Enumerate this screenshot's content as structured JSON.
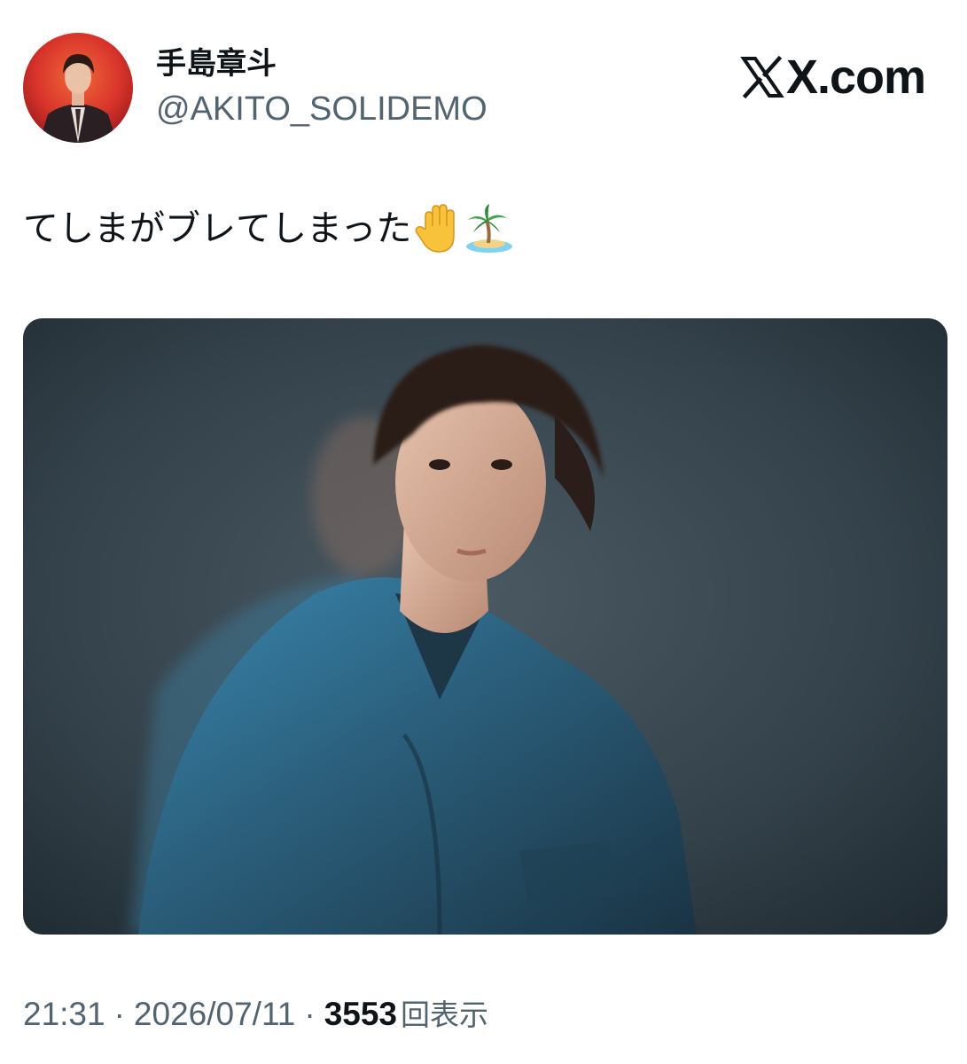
{
  "tweet": {
    "author": {
      "display_name": "手島章斗",
      "handle": "@AKITO_SOLIDEMO"
    },
    "brand": {
      "text": "X.com",
      "icon": "x-logo-icon"
    },
    "text": "てしまがブレてしまった",
    "emojis": [
      "raised-hand-icon",
      "desert-island-icon"
    ],
    "photo": {
      "icon": "photo-portrait"
    },
    "meta": {
      "time": "21:31",
      "separator": "·",
      "date": "2026/07/11",
      "views_count": "3553",
      "views_label": "回表示"
    }
  },
  "colors": {
    "text_primary": "#0f1419",
    "text_secondary": "#536471",
    "background": "#ffffff"
  }
}
